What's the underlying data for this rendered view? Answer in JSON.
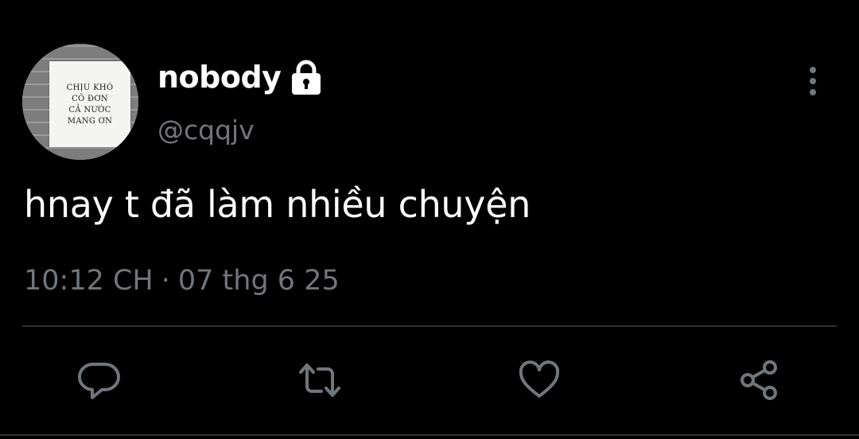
{
  "author": {
    "display_name": "nobody",
    "handle": "@cqqjv",
    "protected_icon": "lock-icon",
    "avatar_sign_lines": [
      "CHỊU KHÓ",
      "CÔ ĐƠN",
      "CẢ NƯỚC",
      "MANG ƠN"
    ]
  },
  "tweet": {
    "text": "hnay t đã làm nhiều chuyện",
    "time": "10:12 CH",
    "separator": "·",
    "date": "07 thg 6 25"
  },
  "menu": {
    "icon": "more-vertical-icon"
  },
  "actions": [
    {
      "name": "reply",
      "icon": "reply-icon"
    },
    {
      "name": "retweet",
      "icon": "retweet-icon"
    },
    {
      "name": "like",
      "icon": "heart-icon"
    },
    {
      "name": "share",
      "icon": "share-icon"
    }
  ],
  "colors": {
    "background": "#000000",
    "primary_text": "#ffffff",
    "secondary_text": "#71767b",
    "divider": "#2f3336",
    "icon": "#71767b"
  }
}
